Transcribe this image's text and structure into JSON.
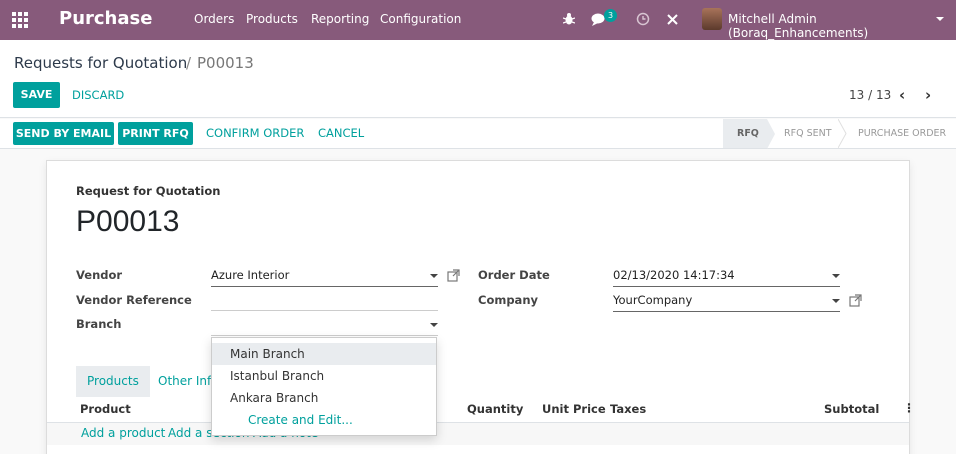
{
  "navbar": {
    "app_name": "Purchase",
    "menu": [
      "Orders",
      "Products",
      "Reporting",
      "Configuration"
    ],
    "chat_count": "3",
    "user": "Mitchell Admin (Boraq_Enhancements)",
    "bg_color": "#875a7b"
  },
  "breadcrumb": {
    "parent": "Requests for Quotation",
    "separator": "/",
    "current": "P00013"
  },
  "actions": {
    "save": "SAVE",
    "discard": "DISCARD"
  },
  "pager": {
    "value": "13 / 13",
    "prev": "‹",
    "next": "›"
  },
  "status_bar": {
    "buttons": [
      "SEND BY EMAIL",
      "PRINT RFQ"
    ],
    "links": [
      "CONFIRM ORDER",
      "CANCEL"
    ],
    "stages": [
      "RFQ",
      "RFQ SENT",
      "PURCHASE ORDER"
    ],
    "active_stage": "RFQ"
  },
  "form": {
    "doc_label": "Request for Quotation",
    "title": "P00013",
    "vendor_label": "Vendor",
    "vendor_value": "Azure Interior",
    "vendor_ref_label": "Vendor Reference",
    "vendor_ref_value": "",
    "branch_label": "Branch",
    "branch_value": "",
    "order_date_label": "Order Date",
    "order_date_value": "02/13/2020 14:17:34",
    "company_label": "Company",
    "company_value": "YourCompany"
  },
  "tabs": [
    {
      "label": "Products",
      "active": true
    },
    {
      "label": "Other Information",
      "active": false
    }
  ],
  "table": {
    "headers": [
      "Product",
      "Quantity",
      "Unit Price",
      "Taxes",
      "Subtotal"
    ],
    "add_links": [
      "Add a product",
      "Add a section",
      "Add a note"
    ]
  },
  "branch_dropdown": {
    "options": [
      "Main Branch",
      "Istanbul Branch",
      "Ankara Branch"
    ],
    "highlighted": "Main Branch",
    "create_label": "Create and Edit..."
  },
  "colors": {
    "accent": "#00a09d",
    "brand": "#875a7b"
  }
}
